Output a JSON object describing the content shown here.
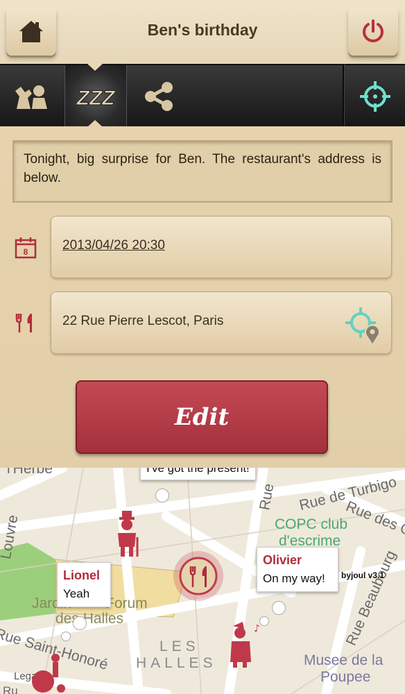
{
  "header": {
    "title": "Ben's birthday",
    "home_icon": "home-icon",
    "power_icon": "power-icon"
  },
  "toolbar": {
    "items": [
      "participants-icon",
      "sleep-zzz-icon",
      "share-icon",
      "locate-icon"
    ]
  },
  "event": {
    "description": "Tonight, big surprise for Ben. The restaurant's address is below.",
    "calendar_day": "8",
    "datetime": "2013/04/26 20:30",
    "address": "22 Rue Pierre Lescot, Paris",
    "edit_label": "Edit"
  },
  "map": {
    "bubbles": [
      {
        "name": "",
        "message": "I've got the present!"
      },
      {
        "name": "Lionel",
        "message": "Yeah"
      },
      {
        "name": "Olivier",
        "message": "On my way!"
      }
    ],
    "labels": {
      "herbe": "l'Herbe",
      "turbigo": "Rue de Turbigo",
      "rue_des": "Rue des G",
      "rue_vert": "Rue",
      "louvre": "Louvre",
      "copc1": "COPC club",
      "copc2": "d'escrime",
      "jardin": "Jardin",
      "forum": "Forum",
      "des_halles": "des Halles",
      "saint_honore": "Rue Saint-Honoré",
      "les": "LES",
      "halles": "HALLES",
      "beaubourg": "Rue Beaubourg",
      "musee1": "Musee de la",
      "musee2": "Poupee",
      "legal": "Legal",
      "ru": "Ru"
    },
    "version": "byjoul v3.1"
  },
  "colors": {
    "accent_red": "#b02c3a",
    "teal": "#5fd3c2",
    "panel_bg": "#e4d2ae"
  }
}
